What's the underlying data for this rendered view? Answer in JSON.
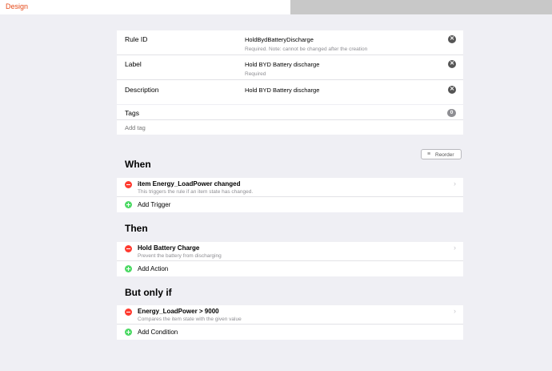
{
  "topbar": {
    "design_tab": "Design"
  },
  "form": {
    "rule_id": {
      "label": "Rule ID",
      "value": "HoldBydBatteryDischarge",
      "hint": "Required. Note: cannot be changed after the creation"
    },
    "label": {
      "label": "Label",
      "value": "Hold BYD Battery discharge",
      "hint": "Required"
    },
    "description": {
      "label": "Description",
      "value": "Hold BYD Battery discharge"
    },
    "clear_glyph": "✕"
  },
  "tags": {
    "label": "Tags",
    "count": "0",
    "placeholder": "Add tag"
  },
  "reorder": {
    "label": "Reorder",
    "icon": "≡"
  },
  "when": {
    "title": "When",
    "item": {
      "title": "item Energy_LoadPower changed",
      "desc": "This triggers the rule if an item state has changed."
    },
    "add_label": "Add Trigger"
  },
  "then": {
    "title": "Then",
    "item": {
      "title": "Hold Battery Charge",
      "desc": "Prevent the battery from discharging"
    },
    "add_label": "Add Action"
  },
  "only_if": {
    "title": "But only if",
    "item": {
      "title": "Energy_LoadPower > 9000",
      "desc": "Compares the item state with the given value"
    },
    "add_label": "Add Condition"
  },
  "chevron_glyph": "›"
}
